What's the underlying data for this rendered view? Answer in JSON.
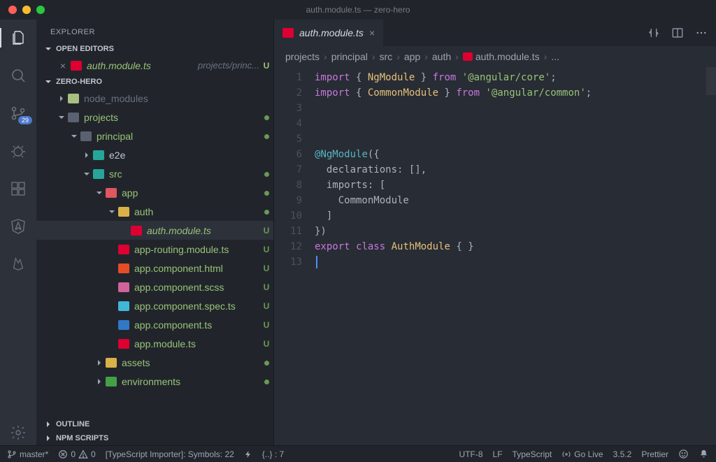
{
  "window": {
    "title": "auth.module.ts — zero-hero"
  },
  "sidebar_title": "EXPLORER",
  "sections": {
    "openEditors": "OPEN EDITORS",
    "workspace": "ZERO-HERO",
    "outline": "OUTLINE",
    "npm": "NPM SCRIPTS"
  },
  "openEditor": {
    "name": "auth.module.ts",
    "path": "projects/princ...",
    "status": "U"
  },
  "tree": [
    {
      "id": "node_modules",
      "kind": "folder",
      "name": "node_modules",
      "depth": 1,
      "expanded": false,
      "iconCls": "fi-folder-green",
      "dimmed": true,
      "git": ""
    },
    {
      "id": "projects",
      "kind": "folder",
      "name": "projects",
      "depth": 1,
      "expanded": true,
      "iconCls": "fi-folder-open",
      "git": "dot"
    },
    {
      "id": "principal",
      "kind": "folder",
      "name": "principal",
      "depth": 2,
      "expanded": true,
      "iconCls": "fi-folder-open",
      "git": "dot"
    },
    {
      "id": "e2e",
      "kind": "folder",
      "name": "e2e",
      "depth": 3,
      "expanded": false,
      "iconCls": "fi-folder-teal",
      "git": ""
    },
    {
      "id": "src",
      "kind": "folder",
      "name": "src",
      "depth": 3,
      "expanded": true,
      "iconCls": "fi-folder-teal",
      "git": "dot"
    },
    {
      "id": "app",
      "kind": "folder",
      "name": "app",
      "depth": 4,
      "expanded": true,
      "iconCls": "fi-folder-red",
      "git": "dot"
    },
    {
      "id": "auth",
      "kind": "folder",
      "name": "auth",
      "depth": 5,
      "expanded": true,
      "iconCls": "fi-folder-yellow",
      "git": "dot"
    },
    {
      "id": "auth.module.ts",
      "kind": "file",
      "name": "auth.module.ts",
      "depth": 6,
      "iconCls": "fi-file-angular",
      "git": "U",
      "selected": true
    },
    {
      "id": "app-routing",
      "kind": "file",
      "name": "app-routing.module.ts",
      "depth": 5,
      "iconCls": "fi-file-angular",
      "git": "U"
    },
    {
      "id": "app.component.html",
      "kind": "file",
      "name": "app.component.html",
      "depth": 5,
      "iconCls": "fi-file-html",
      "git": "U"
    },
    {
      "id": "app.component.scss",
      "kind": "file",
      "name": "app.component.scss",
      "depth": 5,
      "iconCls": "fi-file-scss",
      "git": "U"
    },
    {
      "id": "app.component.spec.ts",
      "kind": "file",
      "name": "app.component.spec.ts",
      "depth": 5,
      "iconCls": "fi-file-spec",
      "git": "U"
    },
    {
      "id": "app.component.ts",
      "kind": "file",
      "name": "app.component.ts",
      "depth": 5,
      "iconCls": "fi-file-ts",
      "git": "U"
    },
    {
      "id": "app.module.ts",
      "kind": "file",
      "name": "app.module.ts",
      "depth": 5,
      "iconCls": "fi-file-angular",
      "git": "U"
    },
    {
      "id": "assets",
      "kind": "folder",
      "name": "assets",
      "depth": 4,
      "expanded": false,
      "iconCls": "fi-folder-yellow",
      "git": "dot"
    },
    {
      "id": "environments",
      "kind": "folder",
      "name": "environments",
      "depth": 4,
      "expanded": false,
      "iconCls": "fi-folder-green2",
      "git": "dot"
    }
  ],
  "tab": {
    "name": "auth.module.ts"
  },
  "breadcrumbs": [
    "projects",
    "principal",
    "src",
    "app",
    "auth",
    "auth.module.ts",
    "..."
  ],
  "code": {
    "lines": [
      {
        "n": 1,
        "html": "<span class='tok-kw'>import</span> { <span class='tok-ty'>NgModule</span> } <span class='tok-kw'>from</span> <span class='tok-str'>'@angular/core'</span>;"
      },
      {
        "n": 2,
        "html": "<span class='tok-kw'>import</span> { <span class='tok-ty'>CommonModule</span> } <span class='tok-kw'>from</span> <span class='tok-str'>'@angular/common'</span>;"
      },
      {
        "n": 3,
        "html": ""
      },
      {
        "n": 4,
        "html": ""
      },
      {
        "n": 5,
        "html": ""
      },
      {
        "n": 6,
        "html": "<span class='tok-at'>@</span><span class='tok-fn'>NgModule</span>({"
      },
      {
        "n": 7,
        "html": "  declarations: [],"
      },
      {
        "n": 8,
        "html": "  imports: ["
      },
      {
        "n": 9,
        "html": "    CommonModule"
      },
      {
        "n": 10,
        "html": "  ]"
      },
      {
        "n": 11,
        "html": "})"
      },
      {
        "n": 12,
        "html": "<span class='tok-kw'>export</span> <span class='tok-kw'>class</span> <span class='tok-ty'>AuthModule</span> { }"
      },
      {
        "n": 13,
        "html": "",
        "cursor": true
      }
    ]
  },
  "status": {
    "branch": "master*",
    "errors": "0",
    "warnings": "0",
    "tsImporter": "[TypeScript Importer]: Symbols: 22",
    "bracketPair": "{..} : 7",
    "encoding": "UTF-8",
    "eol": "LF",
    "lang": "TypeScript",
    "goLive": "Go Live",
    "version": "3.5.2",
    "prettier": "Prettier"
  },
  "scmBadge": "29"
}
